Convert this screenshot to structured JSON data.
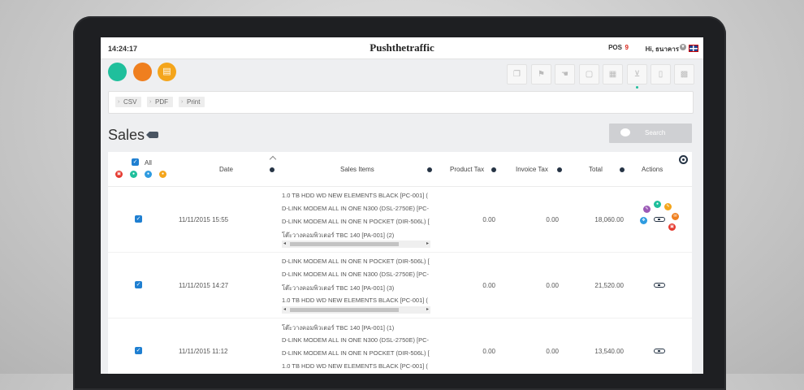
{
  "header": {
    "clock": "14:24:17",
    "brand": "Pushthetraffic",
    "pos_label": "POS",
    "pos_count": "9",
    "greeting": "Hi, ธนาคาร"
  },
  "export": {
    "csv": "CSV",
    "pdf": "PDF",
    "print": "Print"
  },
  "page": {
    "title": "Sales"
  },
  "search": {
    "label": "Search"
  },
  "table": {
    "columns": {
      "all": "All",
      "date": "Date",
      "sales_items": "Sales Items",
      "product_tax": "Product Tax",
      "invoice_tax": "Invoice Tax",
      "total": "Total",
      "actions": "Actions"
    },
    "rows": [
      {
        "date": "11/11/2015 15:55",
        "items": [
          "1.0 TB HDD WD NEW ELEMENTS BLACK [PC-001] (",
          "D-LINK MODEM ALL IN ONE N300 (DSL-2750E) [PC-",
          "D-LINK MODEM ALL IN ONE N POCKET (DIR-506L) [",
          "โต๊ะวางคอมพิวเตอร์ TBC 140 [PA-001] (2)"
        ],
        "product_tax": "0.00",
        "invoice_tax": "0.00",
        "total": "18,060.00"
      },
      {
        "date": "11/11/2015 14:27",
        "items": [
          "D-LINK MODEM ALL IN ONE N POCKET (DIR-506L) [",
          "D-LINK MODEM ALL IN ONE N300 (DSL-2750E) [PC-",
          "โต๊ะวางคอมพิวเตอร์ TBC 140 [PA-001] (3)",
          "1.0 TB HDD WD NEW ELEMENTS BLACK [PC-001] ("
        ],
        "product_tax": "0.00",
        "invoice_tax": "0.00",
        "total": "21,520.00"
      },
      {
        "date": "11/11/2015 11:12",
        "items": [
          "โต๊ะวางคอมพิวเตอร์ TBC 140 [PA-001] (1)",
          "D-LINK MODEM ALL IN ONE N300 (DSL-2750E) [PC-",
          "D-LINK MODEM ALL IN ONE N POCKET (DIR-506L) [",
          "1.0 TB HDD WD NEW ELEMENTS BLACK [PC-001] ("
        ],
        "product_tax": "0.00",
        "invoice_tax": "0.00",
        "total": "13,540.00"
      }
    ]
  },
  "colors": {
    "teal": "#1fbf9c",
    "orange": "#ef7f1f",
    "amber": "#f4a51b",
    "checkbox": "#1f7fd1",
    "pos_count": "#d9261c"
  }
}
